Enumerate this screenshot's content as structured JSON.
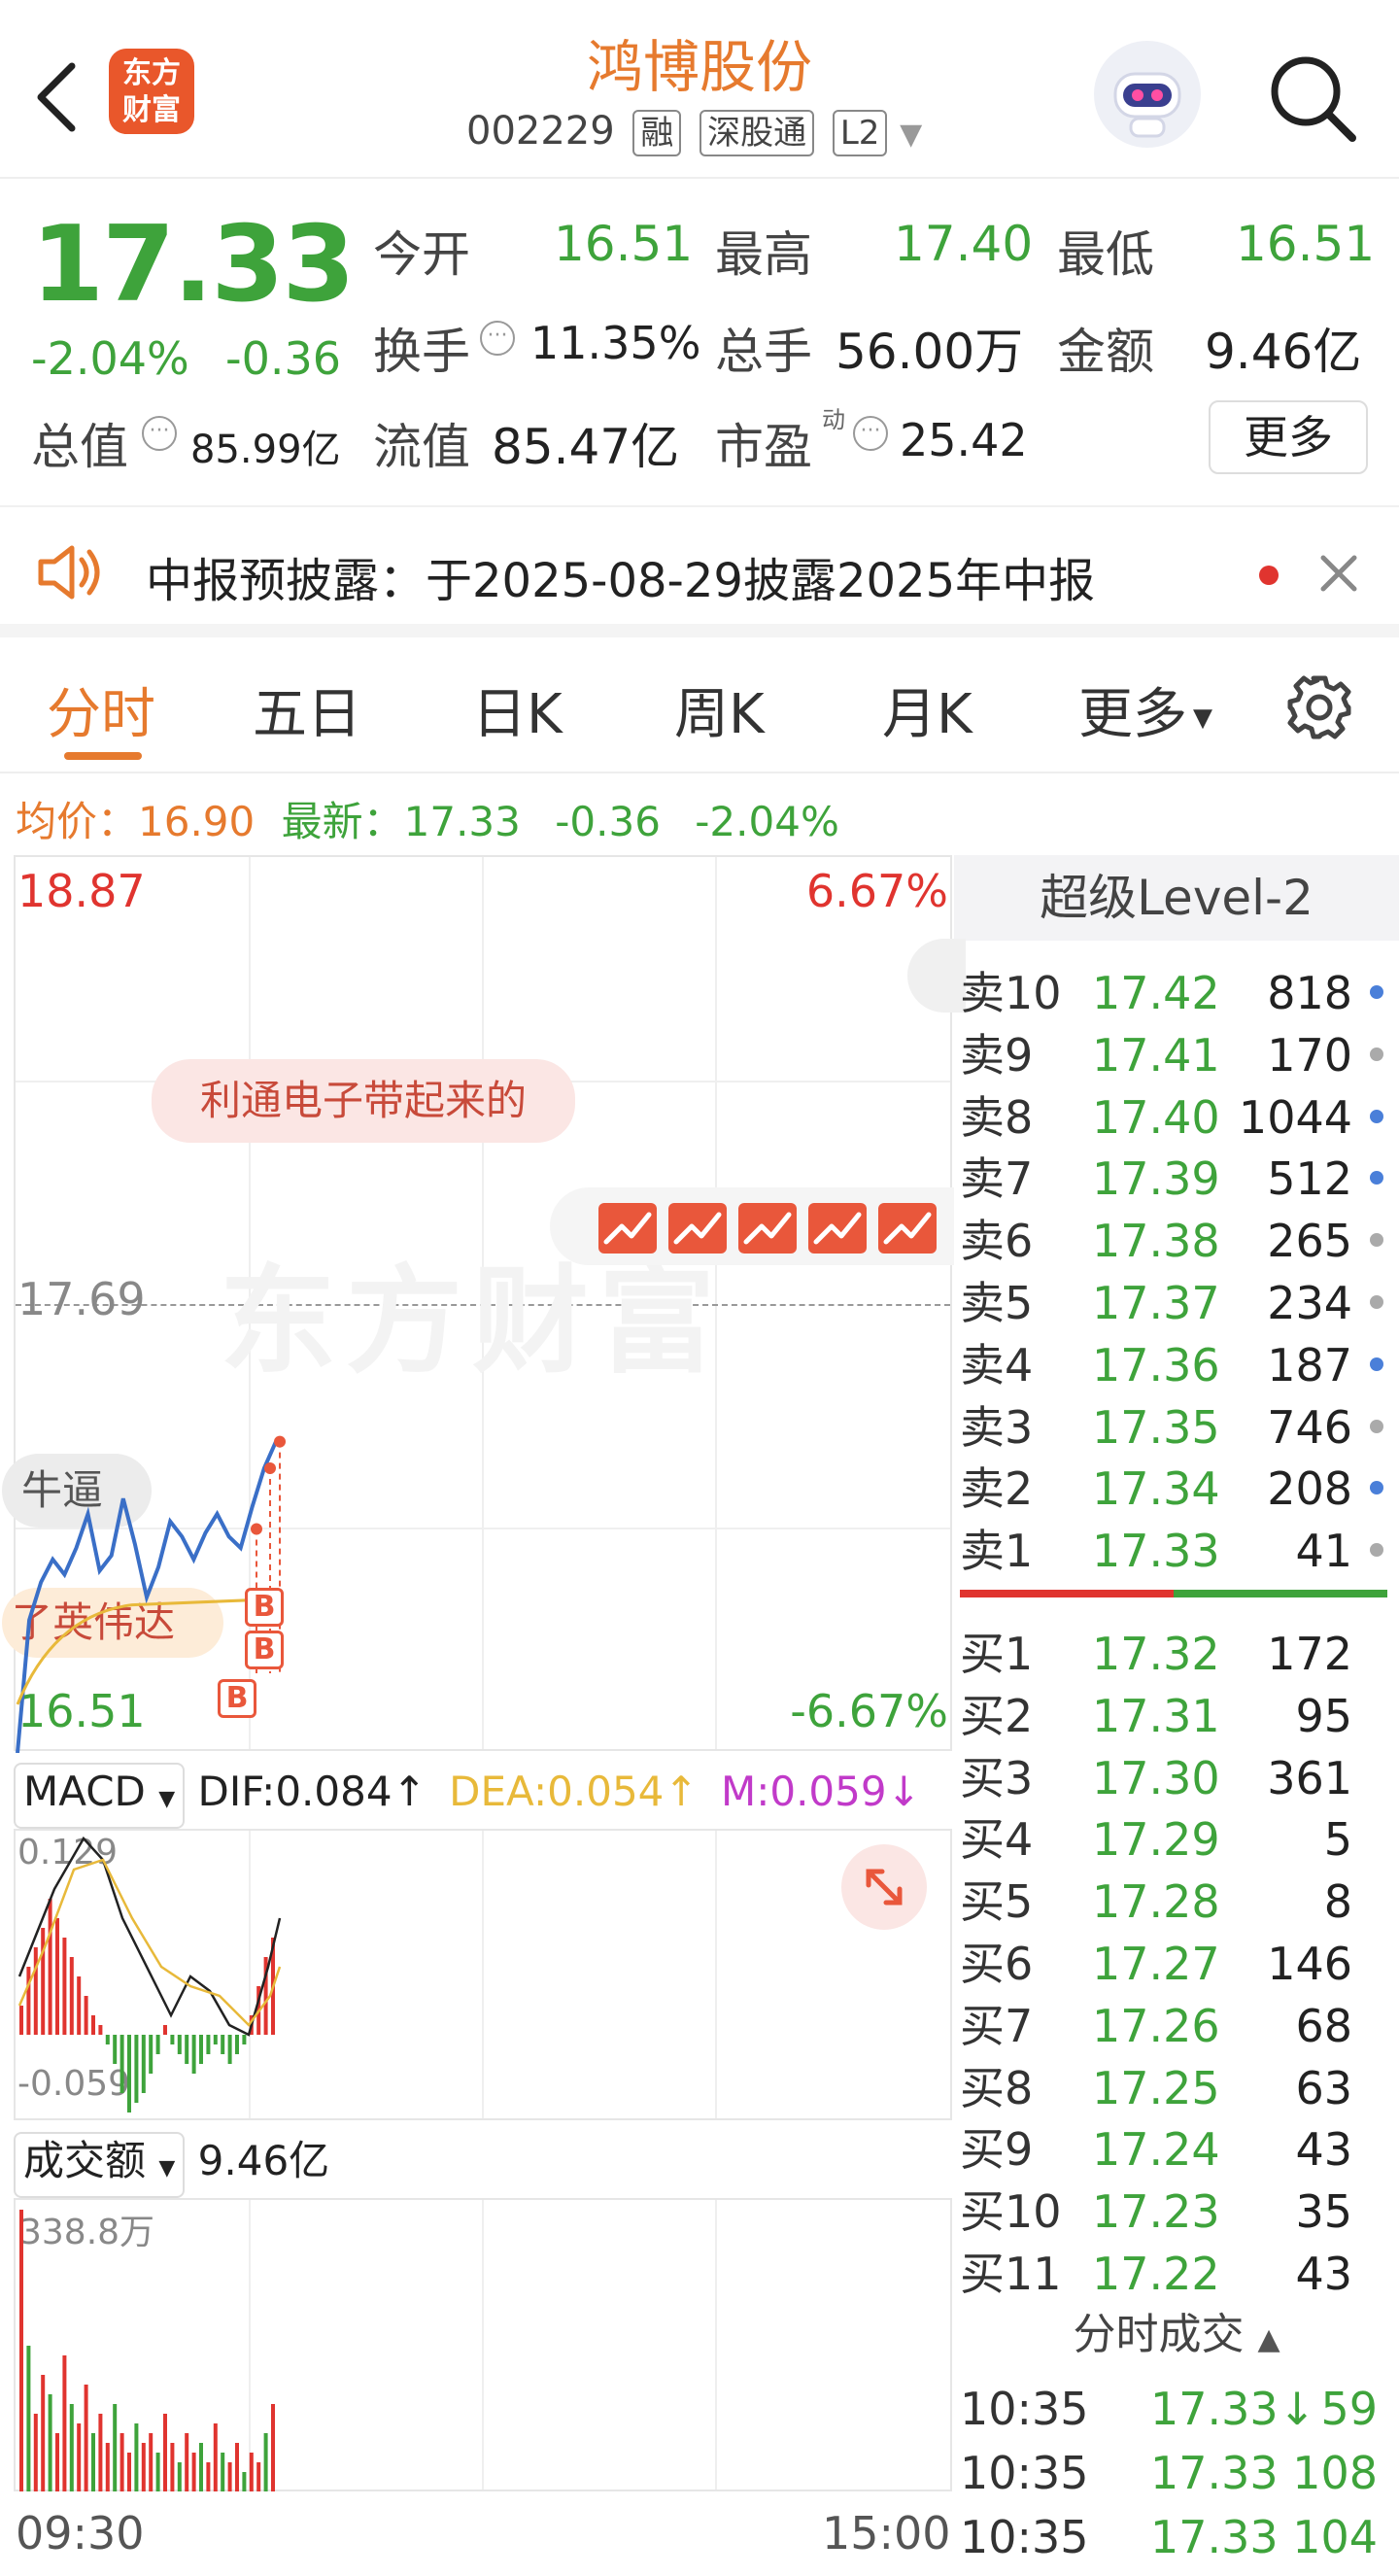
{
  "header": {
    "title": "鸿博股份",
    "code": "002229",
    "tags": [
      "融",
      "深股通",
      "L2"
    ],
    "logo_line1": "东方",
    "logo_line2": "财富"
  },
  "quote": {
    "price": "17.33",
    "change_pct": "-2.04%",
    "change_amt": "-0.36",
    "open_label": "今开",
    "open": "16.51",
    "high_label": "最高",
    "high": "17.40",
    "low_label": "最低",
    "low": "16.51",
    "turnover_label": "换手",
    "turnover": "11.35%",
    "volume_label": "总手",
    "volume": "56.00万",
    "amount_label": "金额",
    "amount": "9.46亿",
    "mcap_label": "总值",
    "mcap": "85.99亿",
    "float_label": "流值",
    "float": "85.47亿",
    "pe_label": "市盈",
    "pe_sup": "动",
    "pe": "25.42",
    "more_label": "更多"
  },
  "notice": {
    "text": "中报预披露：于2025-08-29披露2025年中报"
  },
  "tabs": [
    "分时",
    "五日",
    "日K",
    "周K",
    "月K",
    "更多"
  ],
  "avg_row": {
    "avg_label": "均价：",
    "avg": "16.90",
    "latest_label": "最新：",
    "latest": "17.33",
    "chg": "-0.36",
    "pct": "-2.04%"
  },
  "chart": {
    "y_top": "18.87",
    "y_mid": "17.69",
    "y_bottom": "16.51",
    "pct_top": "6.67%",
    "pct_bottom": "-6.67%",
    "watermark": "东方财富",
    "bubble_1": "利通电子带起来的",
    "bubble_2": "牛逼",
    "bubble_3": "了英伟达",
    "marker": "B",
    "time_start": "09:30",
    "time_end": "15:00"
  },
  "macd": {
    "selector": "MACD",
    "dif": "DIF:0.084",
    "dea": "DEA:0.054",
    "m": "M:0.059",
    "top": "0.129",
    "bottom": "-0.059",
    "colors": {
      "dif": "#222222",
      "dea": "#e8b93a",
      "m": "#c13ac9"
    }
  },
  "volume": {
    "selector": "成交额",
    "total": "9.46亿",
    "max": "338.8万"
  },
  "orderbook": {
    "title": "超级Level-2",
    "asks": [
      {
        "label": "卖10",
        "price": "17.42",
        "qty": "818",
        "dot": "blue"
      },
      {
        "label": "卖9",
        "price": "17.41",
        "qty": "170",
        "dot": "gray"
      },
      {
        "label": "卖8",
        "price": "17.40",
        "qty": "1044",
        "dot": "blue"
      },
      {
        "label": "卖7",
        "price": "17.39",
        "qty": "512",
        "dot": "blue"
      },
      {
        "label": "卖6",
        "price": "17.38",
        "qty": "265",
        "dot": "gray"
      },
      {
        "label": "卖5",
        "price": "17.37",
        "qty": "234",
        "dot": "gray"
      },
      {
        "label": "卖4",
        "price": "17.36",
        "qty": "187",
        "dot": "blue"
      },
      {
        "label": "卖3",
        "price": "17.35",
        "qty": "746",
        "dot": "gray"
      },
      {
        "label": "卖2",
        "price": "17.34",
        "qty": "208",
        "dot": "blue"
      },
      {
        "label": "卖1",
        "price": "17.33",
        "qty": "41",
        "dot": "gray"
      }
    ],
    "bids": [
      {
        "label": "买1",
        "price": "17.32",
        "qty": "172"
      },
      {
        "label": "买2",
        "price": "17.31",
        "qty": "95"
      },
      {
        "label": "买3",
        "price": "17.30",
        "qty": "361"
      },
      {
        "label": "买4",
        "price": "17.29",
        "qty": "5"
      },
      {
        "label": "买5",
        "price": "17.28",
        "qty": "8"
      },
      {
        "label": "买6",
        "price": "17.27",
        "qty": "146"
      },
      {
        "label": "买7",
        "price": "17.26",
        "qty": "68"
      },
      {
        "label": "买8",
        "price": "17.25",
        "qty": "63"
      },
      {
        "label": "买9",
        "price": "17.24",
        "qty": "43"
      },
      {
        "label": "买10",
        "price": "17.23",
        "qty": "35"
      },
      {
        "label": "买11",
        "price": "17.22",
        "qty": "43"
      }
    ],
    "trades_title": "分时成交",
    "trades": [
      {
        "time": "10:35",
        "price": "17.33↓",
        "vol": "59"
      },
      {
        "time": "10:35",
        "price": "17.33",
        "vol": "108"
      },
      {
        "time": "10:35",
        "price": "17.33",
        "vol": "104"
      }
    ]
  },
  "chart_data": {
    "type": "line",
    "x": [
      "09:30",
      "15:00"
    ],
    "y_range": [
      16.51,
      18.87
    ],
    "prev_close": 17.69,
    "latest": 17.33,
    "avg_price": 16.9,
    "series": [
      {
        "values": [
          16.51,
          16.86,
          16.96,
          17.02,
          16.98,
          17.05,
          17.14,
          16.99,
          17.03,
          17.18,
          17.06,
          16.92,
          17.0,
          17.12,
          17.08,
          17.02,
          17.09,
          17.14,
          17.08,
          17.05,
          17.16,
          17.26,
          17.33
        ]
      }
    ]
  }
}
